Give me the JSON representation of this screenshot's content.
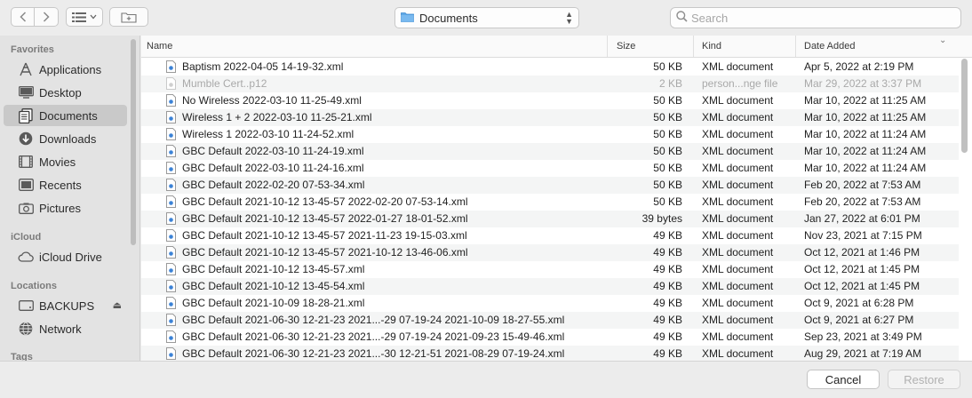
{
  "toolbar": {
    "location": "Documents",
    "search_placeholder": "Search"
  },
  "sidebar": {
    "favorites_label": "Favorites",
    "favorites": [
      {
        "label": "Applications",
        "icon": "applications-icon"
      },
      {
        "label": "Desktop",
        "icon": "desktop-icon"
      },
      {
        "label": "Documents",
        "icon": "documents-icon",
        "selected": true
      },
      {
        "label": "Downloads",
        "icon": "downloads-icon"
      },
      {
        "label": "Movies",
        "icon": "movies-icon"
      },
      {
        "label": "Recents",
        "icon": "recents-icon"
      },
      {
        "label": "Pictures",
        "icon": "pictures-icon"
      }
    ],
    "icloud_label": "iCloud",
    "icloud": [
      {
        "label": "iCloud Drive",
        "icon": "cloud-icon"
      }
    ],
    "locations_label": "Locations",
    "locations": [
      {
        "label": "BACKUPS",
        "icon": "drive-icon"
      },
      {
        "label": "Network",
        "icon": "network-icon"
      }
    ],
    "tags_label": "Tags"
  },
  "list": {
    "columns": [
      "Name",
      "Size",
      "Kind",
      "Date Added"
    ],
    "rows": [
      {
        "name": "Baptism 2022-04-05 14-19-32.xml",
        "size": "50 KB",
        "kind": "XML document",
        "date": "Apr 5, 2022 at 2:19 PM"
      },
      {
        "name": "Mumble Cert..p12",
        "size": "2 KB",
        "kind": "person...nge file",
        "date": "Mar 29, 2022 at 3:37 PM",
        "dimmed": true
      },
      {
        "name": "No Wireless 2022-03-10 11-25-49.xml",
        "size": "50 KB",
        "kind": "XML document",
        "date": "Mar 10, 2022 at 11:25 AM"
      },
      {
        "name": "Wireless 1 + 2 2022-03-10 11-25-21.xml",
        "size": "50 KB",
        "kind": "XML document",
        "date": "Mar 10, 2022 at 11:25 AM"
      },
      {
        "name": "Wireless 1 2022-03-10 11-24-52.xml",
        "size": "50 KB",
        "kind": "XML document",
        "date": "Mar 10, 2022 at 11:24 AM"
      },
      {
        "name": "GBC Default 2022-03-10 11-24-19.xml",
        "size": "50 KB",
        "kind": "XML document",
        "date": "Mar 10, 2022 at 11:24 AM"
      },
      {
        "name": "GBC Default 2022-03-10 11-24-16.xml",
        "size": "50 KB",
        "kind": "XML document",
        "date": "Mar 10, 2022 at 11:24 AM"
      },
      {
        "name": "GBC Default 2022-02-20 07-53-34.xml",
        "size": "50 KB",
        "kind": "XML document",
        "date": "Feb 20, 2022 at 7:53 AM"
      },
      {
        "name": "GBC Default 2021-10-12 13-45-57 2022-02-20 07-53-14.xml",
        "size": "50 KB",
        "kind": "XML document",
        "date": "Feb 20, 2022 at 7:53 AM"
      },
      {
        "name": "GBC Default 2021-10-12 13-45-57 2022-01-27 18-01-52.xml",
        "size": "39 bytes",
        "kind": "XML document",
        "date": "Jan 27, 2022 at 6:01 PM"
      },
      {
        "name": "GBC Default 2021-10-12 13-45-57 2021-11-23 19-15-03.xml",
        "size": "49 KB",
        "kind": "XML document",
        "date": "Nov 23, 2021 at 7:15 PM"
      },
      {
        "name": "GBC Default 2021-10-12 13-45-57 2021-10-12 13-46-06.xml",
        "size": "49 KB",
        "kind": "XML document",
        "date": "Oct 12, 2021 at 1:46 PM"
      },
      {
        "name": "GBC Default 2021-10-12 13-45-57.xml",
        "size": "49 KB",
        "kind": "XML document",
        "date": "Oct 12, 2021 at 1:45 PM"
      },
      {
        "name": "GBC Default 2021-10-12 13-45-54.xml",
        "size": "49 KB",
        "kind": "XML document",
        "date": "Oct 12, 2021 at 1:45 PM"
      },
      {
        "name": "GBC Default 2021-10-09 18-28-21.xml",
        "size": "49 KB",
        "kind": "XML document",
        "date": "Oct 9, 2021 at 6:28 PM"
      },
      {
        "name": "GBC Default 2021-06-30 12-21-23 2021...-29 07-19-24 2021-10-09 18-27-55.xml",
        "size": "49 KB",
        "kind": "XML document",
        "date": "Oct 9, 2021 at 6:27 PM"
      },
      {
        "name": "GBC Default 2021-06-30 12-21-23 2021...-29 07-19-24 2021-09-23 15-49-46.xml",
        "size": "49 KB",
        "kind": "XML document",
        "date": "Sep 23, 2021 at 3:49 PM"
      },
      {
        "name": "GBC Default 2021-06-30 12-21-23 2021...-30 12-21-51 2021-08-29 07-19-24.xml",
        "size": "49 KB",
        "kind": "XML document",
        "date": "Aug 29, 2021 at 7:19 AM"
      }
    ]
  },
  "buttons": {
    "cancel": "Cancel",
    "restore": "Restore"
  },
  "colors": {
    "accent": "#3b82d6",
    "selection": "#c9c9c9"
  }
}
